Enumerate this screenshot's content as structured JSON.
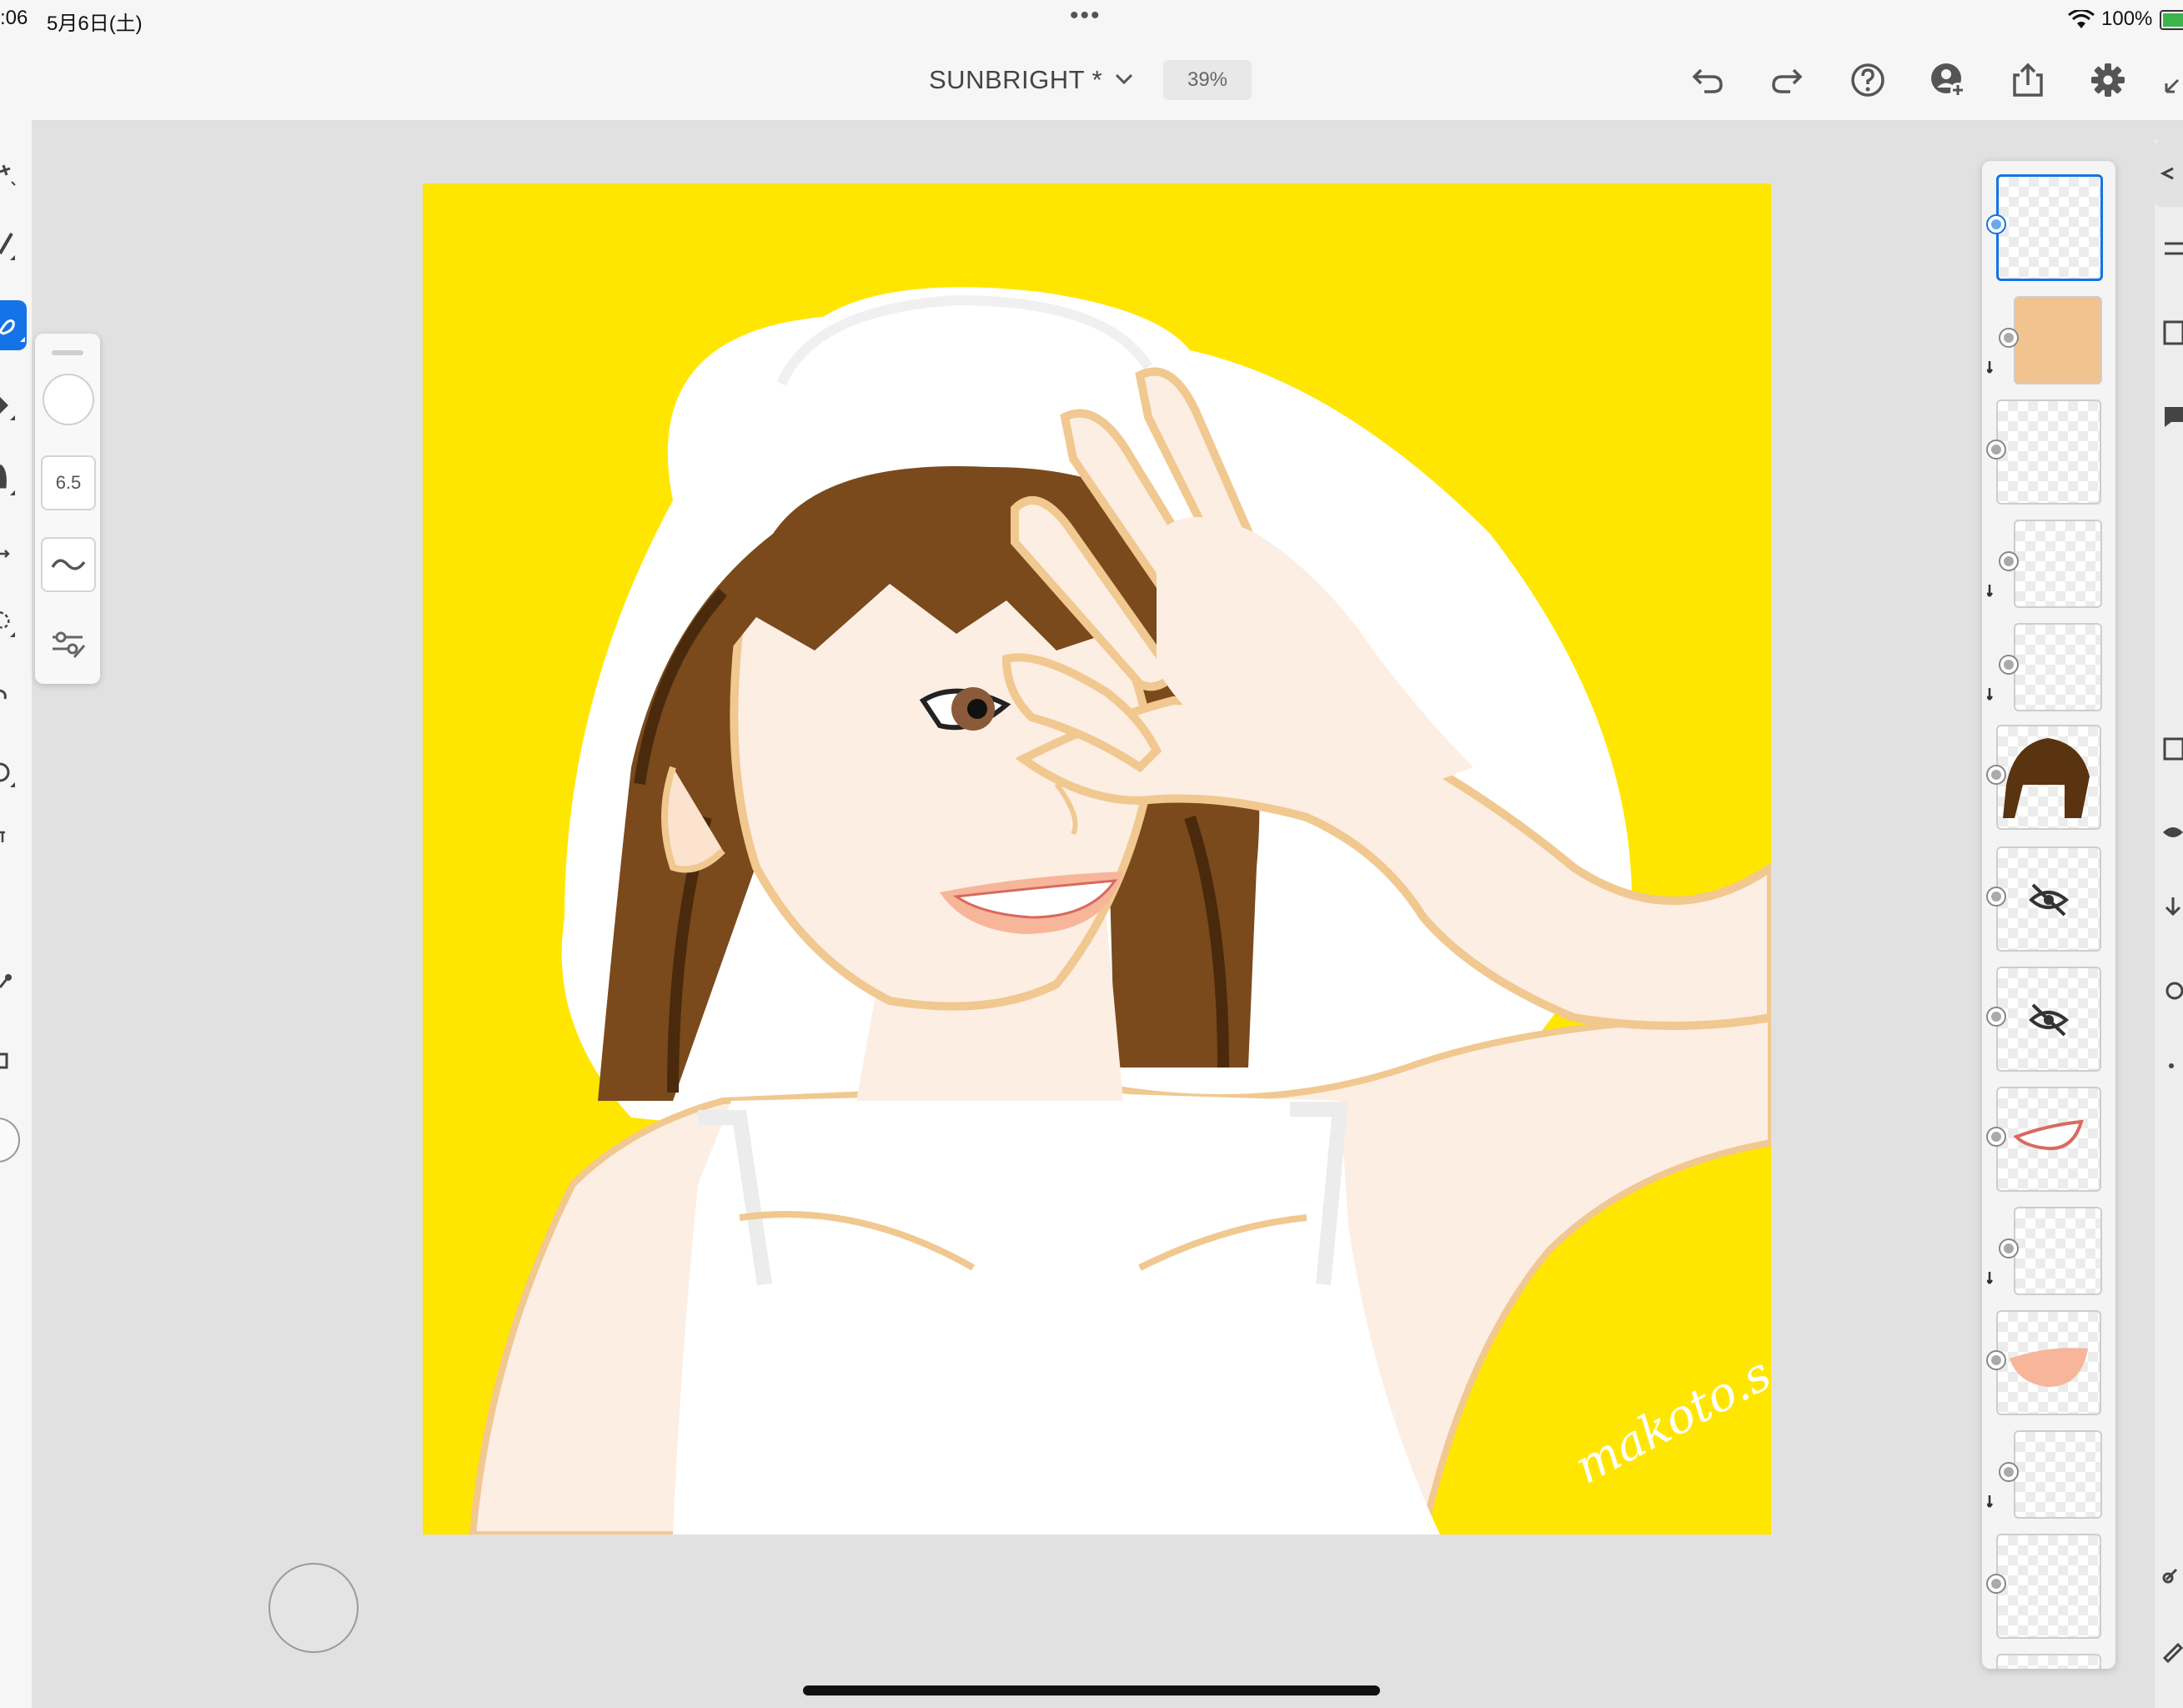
{
  "status_bar": {
    "time": ":06",
    "date": "5月6日(土)",
    "dots": "•••",
    "battery_pct": "100%",
    "battery_color": "#3cb44b"
  },
  "toolbar": {
    "doc_title": "SUNBRIGHT *",
    "zoom": "39%",
    "icons": [
      "undo-icon",
      "redo-icon",
      "help-icon",
      "invite-user-icon",
      "share-icon",
      "settings-icon",
      "collapse-icon"
    ]
  },
  "brush_panel": {
    "size": "6.5",
    "color": "#ffffff"
  },
  "canvas": {
    "background": "#ffe600",
    "signature": "makoto.s"
  },
  "layers_panel": {
    "count_visible": 13
  },
  "colors": {
    "accent": "#1473e6",
    "skin": "#fdeee3",
    "skin_outline": "#f0c890",
    "hair": "#7a4a1c",
    "hair_dark": "#4a2a0c"
  }
}
